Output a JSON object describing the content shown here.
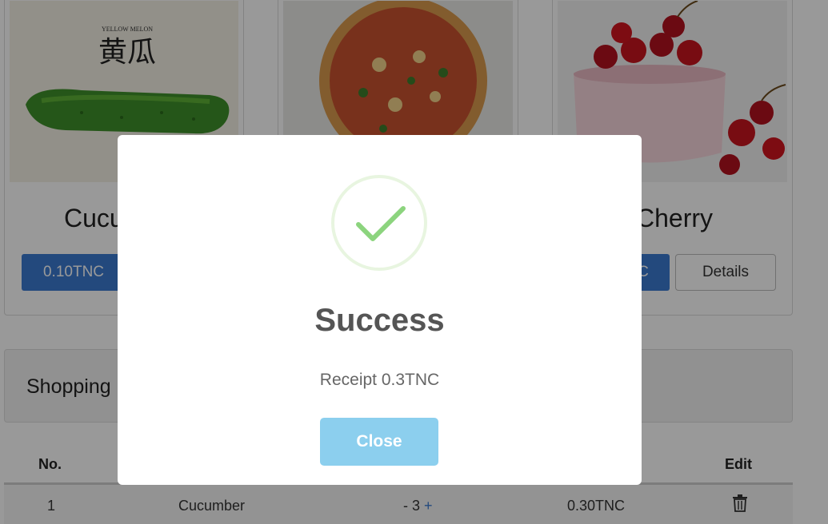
{
  "products": [
    {
      "name": "Cucumber",
      "name_visible": "Cucu",
      "price": "0.10TNC",
      "image_label_top": "YELLOW    MELON",
      "image_label_cn": "黄瓜"
    },
    {
      "name": "Pizza"
    },
    {
      "name_visible": "Cherry",
      "price_visible": "C",
      "details_label": "Details"
    }
  ],
  "cart": {
    "title": "Shopping",
    "columns": {
      "no": "No.",
      "edit": "Edit"
    },
    "rows": [
      {
        "no": "1",
        "name": "Cucumber",
        "qty_minus": "-",
        "qty": "3",
        "qty_plus": "+",
        "subtotal": "0.30TNC"
      }
    ]
  },
  "modal": {
    "title": "Success",
    "message": "Receipt 0.3TNC",
    "close_label": "Close"
  },
  "colors": {
    "primary": "#3b7bd1",
    "success": "#8cd47e",
    "close_button": "#8ccfee"
  }
}
